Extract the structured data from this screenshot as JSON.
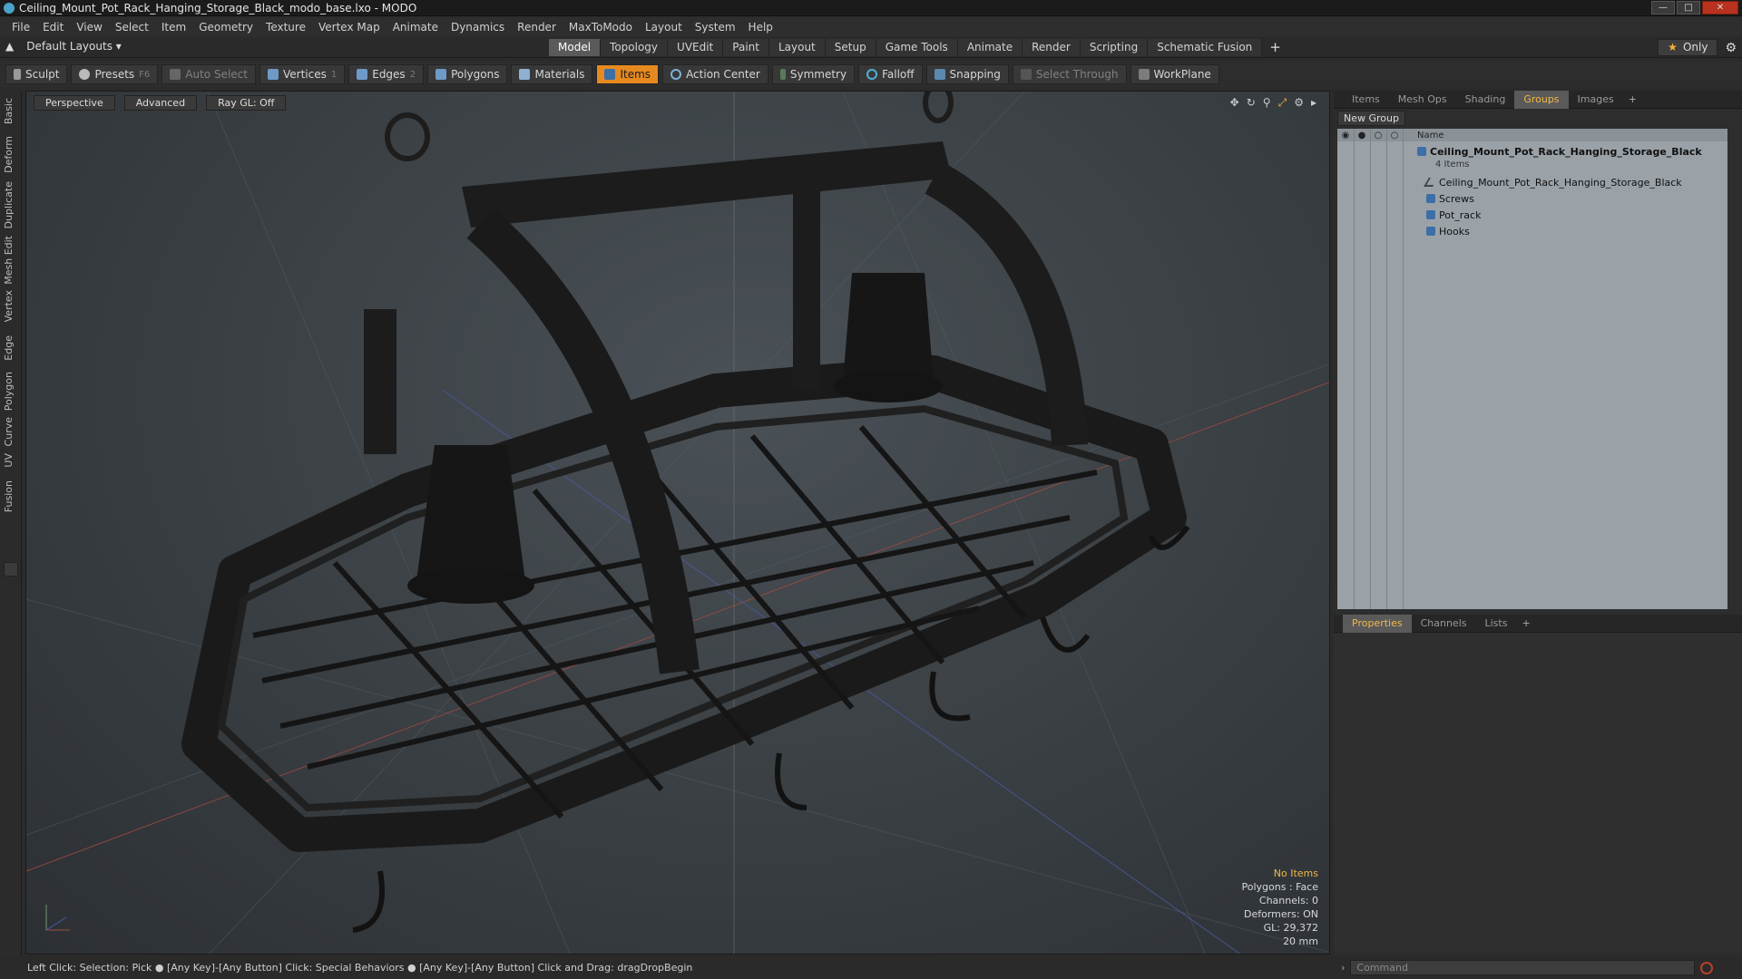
{
  "window": {
    "title": "Ceiling_Mount_Pot_Rack_Hanging_Storage_Black_modo_base.lxo - MODO"
  },
  "menu": [
    "File",
    "Edit",
    "View",
    "Select",
    "Item",
    "Geometry",
    "Texture",
    "Vertex Map",
    "Animate",
    "Dynamics",
    "Render",
    "MaxToModo",
    "Layout",
    "System",
    "Help"
  ],
  "layoutbar": {
    "layout_label": "Default Layouts ▾",
    "tabs": [
      "Model",
      "Topology",
      "UVEdit",
      "Paint",
      "Layout",
      "Setup",
      "Game Tools",
      "Animate",
      "Render",
      "Scripting",
      "Schematic Fusion"
    ],
    "active_tab": "Model",
    "plus": "+",
    "only_label": "Only"
  },
  "toolbar": {
    "sculpt": "Sculpt",
    "presets": "Presets",
    "presets_key": "F6",
    "auto_select": "Auto Select",
    "vertices": "Vertices",
    "vertices_count": "1",
    "edges": "Edges",
    "edges_count": "2",
    "polygons": "Polygons",
    "materials": "Materials",
    "items": "Items",
    "action_center": "Action Center",
    "symmetry": "Symmetry",
    "falloff": "Falloff",
    "snapping": "Snapping",
    "select_through": "Select Through",
    "workplane": "WorkPlane"
  },
  "lefttabs": [
    "Basic",
    "Deform",
    "Duplicate",
    "Mesh Edit",
    "Vertex",
    "Edge",
    "Polygon",
    "Curve",
    "UV",
    "Fusion"
  ],
  "viewport": {
    "view_label": "Perspective",
    "shading_label": "Advanced",
    "raygl_label": "Ray GL: Off",
    "stats": {
      "selection": "No Items",
      "polygons": "Polygons : Face",
      "channels": "Channels: 0",
      "deformers": "Deformers: ON",
      "gl": "GL: 29,372",
      "scale": "20 mm"
    }
  },
  "statusbar": {
    "text": "Left Click: Selection: Pick ●  [Any Key]-[Any Button] Click: Special Behaviors ●  [Any Key]-[Any Button] Click and Drag: dragDropBegin"
  },
  "rightpanel": {
    "top_tabs": [
      "Items",
      "Mesh Ops",
      "Shading",
      "Groups",
      "Images"
    ],
    "active_top_tab": "Groups",
    "new_group": "New Group",
    "name_header": "Name",
    "group": {
      "name": "Ceiling_Mount_Pot_Rack_Hanging_Storage_Black",
      "count": "4 Items",
      "children": [
        "Ceiling_Mount_Pot_Rack_Hanging_Storage_Black",
        "Screws",
        "Pot_rack",
        "Hooks"
      ]
    },
    "bottom_tabs": [
      "Properties",
      "Channels",
      "Lists"
    ],
    "active_bottom_tab": "Properties",
    "command_placeholder": "Command"
  },
  "colors": {
    "accent": "#e68a1f",
    "highlight_text": "#f2b845",
    "groups_bg": "#9aa2a8"
  }
}
